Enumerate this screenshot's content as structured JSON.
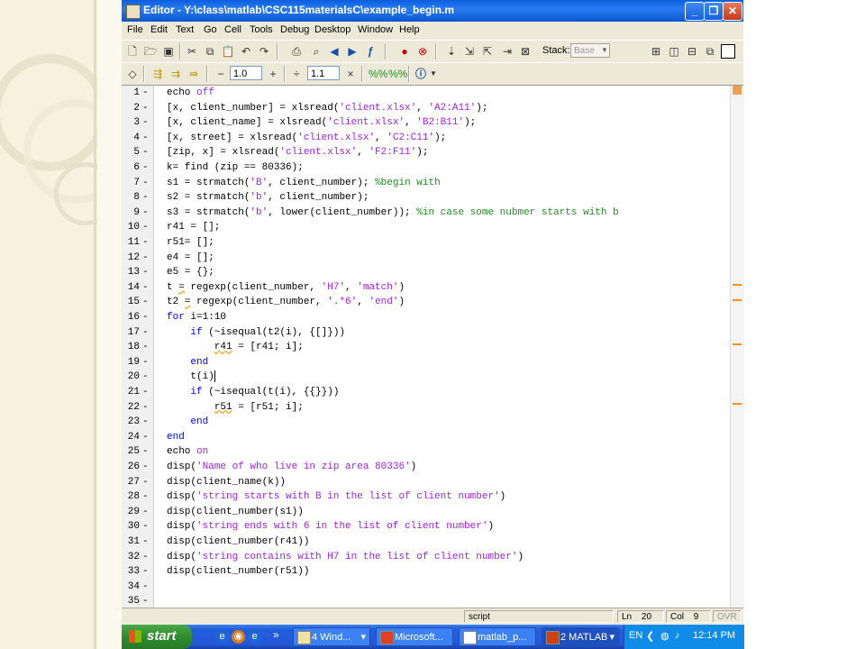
{
  "window": {
    "title": "Editor - Y:\\class\\matlab\\CSC115materialsC\\example_begin.m",
    "buttons": {
      "minimize": "_",
      "maximize": "❐",
      "close": "✕"
    }
  },
  "menu": [
    "File",
    "Edit",
    "Text",
    "Go",
    "Cell",
    "Tools",
    "Debug",
    "Desktop",
    "Window",
    "Help"
  ],
  "toolbar": {
    "stack_label": "Stack:",
    "stack_value": "Base",
    "cell_minus": "−",
    "cell_value_1": "1.0",
    "cell_plus": "+",
    "divide": "÷",
    "cell_value_2": "1.1",
    "times": "×"
  },
  "code": {
    "lines": [
      {
        "n": "1",
        "segs": [
          {
            "t": "echo "
          },
          {
            "t": "off",
            "c": "str"
          }
        ]
      },
      {
        "n": "2",
        "segs": [
          {
            "t": "[x, client_number] = xlsread("
          },
          {
            "t": "'client.xlsx'",
            "c": "str"
          },
          {
            "t": ", "
          },
          {
            "t": "'A2:A11'",
            "c": "str"
          },
          {
            "t": ");"
          }
        ]
      },
      {
        "n": "3",
        "segs": [
          {
            "t": "[x, client_name] = xlsread("
          },
          {
            "t": "'client.xlsx'",
            "c": "str"
          },
          {
            "t": ", "
          },
          {
            "t": "'B2:B11'",
            "c": "str"
          },
          {
            "t": ");"
          }
        ]
      },
      {
        "n": "4",
        "segs": [
          {
            "t": "[x, street] = xlsread("
          },
          {
            "t": "'client.xlsx'",
            "c": "str"
          },
          {
            "t": ", "
          },
          {
            "t": "'C2:C11'",
            "c": "str"
          },
          {
            "t": ");"
          }
        ]
      },
      {
        "n": "5",
        "segs": [
          {
            "t": "[zip, x] = xlsread("
          },
          {
            "t": "'client.xlsx'",
            "c": "str"
          },
          {
            "t": ", "
          },
          {
            "t": "'F2:F11'",
            "c": "str"
          },
          {
            "t": ");"
          }
        ]
      },
      {
        "n": "6",
        "segs": [
          {
            "t": "k= find (zip == 80336);"
          }
        ]
      },
      {
        "n": "7",
        "segs": [
          {
            "t": "s1 = strmatch("
          },
          {
            "t": "'B'",
            "c": "str"
          },
          {
            "t": ", client_number); "
          },
          {
            "t": "%begin with",
            "c": "cm"
          }
        ]
      },
      {
        "n": "8",
        "segs": [
          {
            "t": "s2 = strmatch("
          },
          {
            "t": "'b'",
            "c": "str"
          },
          {
            "t": ", client_number);"
          }
        ]
      },
      {
        "n": "9",
        "segs": [
          {
            "t": "s3 = strmatch("
          },
          {
            "t": "'b'",
            "c": "str"
          },
          {
            "t": ", lower(client_number)); "
          },
          {
            "t": "%in case some nubmer starts with b",
            "c": "cm"
          }
        ]
      },
      {
        "n": "10",
        "segs": [
          {
            "t": "r41 = [];"
          }
        ]
      },
      {
        "n": "11",
        "segs": [
          {
            "t": "r51= [];"
          }
        ]
      },
      {
        "n": "12",
        "segs": [
          {
            "t": "e4 = [];"
          }
        ]
      },
      {
        "n": "13",
        "segs": [
          {
            "t": "e5 = {};"
          }
        ]
      },
      {
        "n": "14",
        "segs": [
          {
            "t": "t "
          },
          {
            "t": "=",
            "c": "sq"
          },
          {
            "t": " regexp(client_number, "
          },
          {
            "t": "'H7'",
            "c": "str"
          },
          {
            "t": ", "
          },
          {
            "t": "'match'",
            "c": "str"
          },
          {
            "t": ")"
          }
        ]
      },
      {
        "n": "15",
        "segs": [
          {
            "t": "t2 "
          },
          {
            "t": "=",
            "c": "sq"
          },
          {
            "t": " regexp(client_number, "
          },
          {
            "t": "'.*6'",
            "c": "str"
          },
          {
            "t": ", "
          },
          {
            "t": "'end'",
            "c": "str"
          },
          {
            "t": ")"
          }
        ]
      },
      {
        "n": "16",
        "segs": [
          {
            "t": "for",
            "c": "kw"
          },
          {
            "t": " i=1:10"
          }
        ]
      },
      {
        "n": "17",
        "segs": [
          {
            "t": "    "
          },
          {
            "t": "if",
            "c": "kw"
          },
          {
            "t": " (~isequal(t2(i), {[]}))"
          }
        ]
      },
      {
        "n": "18",
        "segs": [
          {
            "t": "        "
          },
          {
            "t": "r41",
            "c": "sq"
          },
          {
            "t": " = [r41; i];"
          }
        ]
      },
      {
        "n": "19",
        "segs": [
          {
            "t": "    "
          },
          {
            "t": "end",
            "c": "kw"
          }
        ]
      },
      {
        "n": "20",
        "segs": [
          {
            "t": "    t(i)"
          },
          {
            "t": "|",
            "c": "cursor"
          }
        ]
      },
      {
        "n": "21",
        "segs": [
          {
            "t": "    "
          },
          {
            "t": "if",
            "c": "kw"
          },
          {
            "t": " (~isequal(t(i), {{}}))"
          }
        ]
      },
      {
        "n": "22",
        "segs": [
          {
            "t": "        "
          },
          {
            "t": "r51",
            "c": "sq"
          },
          {
            "t": " = [r51; i];"
          }
        ]
      },
      {
        "n": "23",
        "segs": [
          {
            "t": "    "
          },
          {
            "t": "end",
            "c": "kw"
          }
        ]
      },
      {
        "n": "24",
        "segs": [
          {
            "t": "end",
            "c": "kw"
          }
        ]
      },
      {
        "n": "25",
        "segs": [
          {
            "t": "echo "
          },
          {
            "t": "on",
            "c": "str"
          }
        ]
      },
      {
        "n": "26",
        "segs": [
          {
            "t": "disp("
          },
          {
            "t": "'Name of who live in zip area 80336'",
            "c": "str"
          },
          {
            "t": ")"
          }
        ]
      },
      {
        "n": "27",
        "segs": [
          {
            "t": "disp(client_name(k))"
          }
        ]
      },
      {
        "n": "28",
        "segs": [
          {
            "t": "disp("
          },
          {
            "t": "'string starts with B in the list of client number'",
            "c": "str"
          },
          {
            "t": ")"
          }
        ]
      },
      {
        "n": "29",
        "segs": [
          {
            "t": "disp(client_number(s1))"
          }
        ]
      },
      {
        "n": "30",
        "segs": [
          {
            "t": "disp("
          },
          {
            "t": "'string ends with 6 in the list of client number'",
            "c": "str"
          },
          {
            "t": ")"
          }
        ]
      },
      {
        "n": "31",
        "segs": [
          {
            "t": "disp(client_number(r41))"
          }
        ]
      },
      {
        "n": "32",
        "segs": [
          {
            "t": "disp("
          },
          {
            "t": "'string contains with H7 in the list of client number'",
            "c": "str"
          },
          {
            "t": ")"
          }
        ]
      },
      {
        "n": "33",
        "segs": [
          {
            "t": "disp(client_number(r51))"
          }
        ]
      },
      {
        "n": "34",
        "segs": []
      },
      {
        "n": "35",
        "segs": []
      }
    ]
  },
  "status": {
    "mode": "script",
    "ln_label": "Ln",
    "ln": "20",
    "col_label": "Col",
    "col": "9",
    "ovr": "OVR"
  },
  "taskbar": {
    "start": "start",
    "chevron": "»",
    "buttons": [
      {
        "label": "4 Wind...",
        "arrow": "▾"
      },
      {
        "label": "Microsoft...",
        "arrow": ""
      },
      {
        "label": "matlab_p...",
        "arrow": ""
      },
      {
        "label": "2 MATLAB",
        "arrow": "▾"
      }
    ],
    "lang": "EN",
    "clock": "12:14 PM"
  },
  "colors": {
    "keyword": "#0000ff",
    "string": "#a020f0",
    "comment": "#228b22",
    "accent": "#f09020"
  }
}
